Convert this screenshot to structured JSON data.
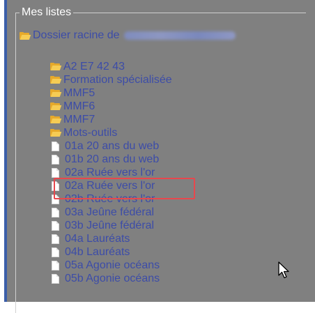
{
  "legend": "Mes listes",
  "root": {
    "label": "Dossier racine de",
    "owner_name": "Rudolf Claude-Alain"
  },
  "items": [
    {
      "type": "folder",
      "label": "A2 E7 42 43"
    },
    {
      "type": "folder",
      "label": "Formation spécialisée"
    },
    {
      "type": "folder",
      "label": "MMF5"
    },
    {
      "type": "folder",
      "label": "MMF6"
    },
    {
      "type": "folder",
      "label": "MMF7"
    },
    {
      "type": "folder",
      "label": "Mots-outils"
    },
    {
      "type": "list",
      "label": "01a 20 ans du web"
    },
    {
      "type": "list",
      "label": "01b 20 ans du web"
    },
    {
      "type": "list",
      "label": "02a Ruée vers l'or",
      "highlighted": true
    },
    {
      "type": "list",
      "label": "02a Ruée vers l'or"
    },
    {
      "type": "list",
      "label": "02b Ruée vers l'or"
    },
    {
      "type": "list",
      "label": "03a Jeûne fédéral"
    },
    {
      "type": "list",
      "label": "03b Jeûne fédéral"
    },
    {
      "type": "list",
      "label": "04a Lauréats"
    },
    {
      "type": "list",
      "label": "04b Lauréats"
    },
    {
      "type": "list",
      "label": "05a Agonie océans"
    },
    {
      "type": "list",
      "label": "05b Agonie océans"
    }
  ],
  "colors": {
    "panel_bg": "#808080",
    "link": "#3c4ca8",
    "highlight": "#e8474d",
    "folder": "#f6cc54"
  }
}
